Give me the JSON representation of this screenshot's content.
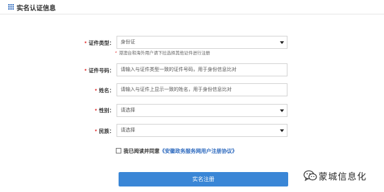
{
  "header": {
    "title": "实名认证信息",
    "icon": "grid-icon"
  },
  "form": {
    "id_type": {
      "label": "证件类型：",
      "value": "身份证"
    },
    "id_type_hint": "港澳台和海外用户请下拉选择其他证件进行注册",
    "id_number": {
      "label": "证件号码：",
      "placeholder": "请输入与证件类型一致的证件号码，用于身份信息比对"
    },
    "name": {
      "label": "姓名：",
      "placeholder": "请输入与证件上显示一致的姓名，用于身份信息比对"
    },
    "gender": {
      "label": "性别：",
      "value": "请选择"
    },
    "ethnicity": {
      "label": "民族：",
      "value": "请选择"
    },
    "agreement": {
      "prefix": "我已阅读并同意",
      "link": "《安徽政务服务网用户注册协议》"
    },
    "submit_label": "实名注册"
  },
  "watermark": {
    "text": "蒙城信息化"
  },
  "colors": {
    "accent": "#3a86d6",
    "required": "#e02020",
    "link": "#2f6bbf"
  }
}
